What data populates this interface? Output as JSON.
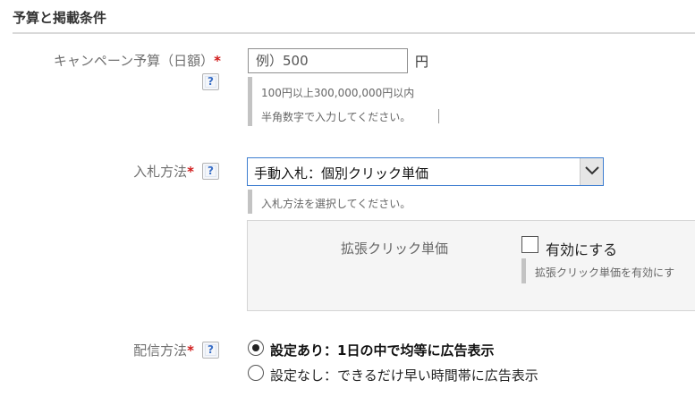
{
  "section": {
    "title": "予算と掲載条件"
  },
  "budget": {
    "label": "キャンペーン予算（日額）",
    "required_mark": "*",
    "help": "?",
    "placeholder": "例）500",
    "value": "",
    "unit": "円",
    "hints": [
      "100円以上300,000,000円以内",
      "半角数字で入力してください。"
    ]
  },
  "bidding": {
    "label": "入札方法",
    "required_mark": "*",
    "help": "?",
    "selected": "手動入札：個別クリック単価",
    "hint": "入札方法を選択してください。",
    "enhanced_cpc": {
      "label": "拡張クリック単価",
      "checkbox_label": "有効にする",
      "checked": false,
      "hint": "拡張クリック単価を有効にす"
    }
  },
  "delivery": {
    "label": "配信方法",
    "required_mark": "*",
    "help": "?",
    "options": [
      {
        "label": "設定あり：1日の中で均等に広告表示",
        "selected": true
      },
      {
        "label": "設定なし：できるだけ早い時間帯に広告表示",
        "selected": false
      }
    ]
  },
  "colors": {
    "required": "#d01818",
    "help_icon": "#3a6fc6",
    "select_border": "#3e7ed0"
  },
  "icons": {
    "help": "help-icon",
    "select": "chevron-down-icon"
  }
}
